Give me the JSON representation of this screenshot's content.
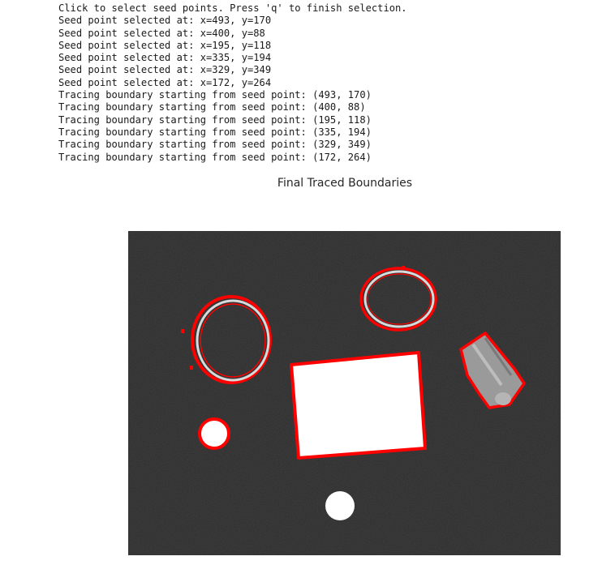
{
  "console": {
    "lines": [
      "Click to select seed points. Press 'q' to finish selection.",
      "Seed point selected at: x=493, y=170",
      "Seed point selected at: x=400, y=88",
      "Seed point selected at: x=195, y=118",
      "Seed point selected at: x=335, y=194",
      "Seed point selected at: x=329, y=349",
      "Seed point selected at: x=172, y=264",
      "Tracing boundary starting from seed point: (493, 170)",
      "Tracing boundary starting from seed point: (400, 88)",
      "Tracing boundary starting from seed point: (195, 118)",
      "Tracing boundary starting from seed point: (335, 194)",
      "Tracing boundary starting from seed point: (329, 349)",
      "Tracing boundary starting from seed point: (172, 264)"
    ]
  },
  "figure": {
    "title": "Final Traced Boundaries",
    "colors": {
      "background": "#2c2c2c",
      "boundary": "#ff0000",
      "object_fill": "#ffffff",
      "ring_stroke": "#d9d9d9",
      "bolt_fill": "#9a9a9a"
    }
  }
}
